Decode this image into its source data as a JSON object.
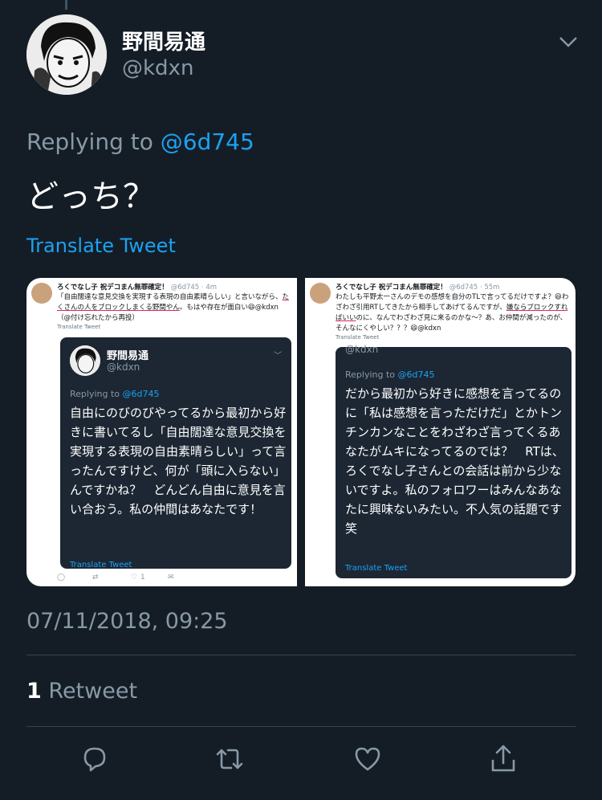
{
  "author": {
    "display_name": "野間易通",
    "handle": "@kdxn"
  },
  "reply": {
    "prefix": "Replying to",
    "target": "@6d745"
  },
  "tweet_text": "どっち？",
  "translate_label": "Translate Tweet",
  "timestamp": "07/11/2018, 09:25",
  "retweets": {
    "count": "1",
    "label": "Retweet"
  },
  "media": {
    "left": {
      "header_name": "ろくでなし子 祝デコまん無罪確定！",
      "header_meta": "@6d745 · 4m",
      "body_before": "「自由闊達な意見交換を実現する表現の自由素晴らしい」と言いながら、",
      "body_underlined": "たくさんの人をブロックしまくる野間やん",
      "body_after": "。もはや存在が面白い😆@kdxn （@付け忘れたから再投）",
      "translate": "Translate Tweet",
      "quoted": {
        "name": "野間易通",
        "handle": "@kdxn",
        "reply_prefix": "Replying to",
        "reply_target": "@6d745",
        "text": "自由にのびのびやってるから最初から好きに書いてるし「自由闊達な意見交換を実現する表現の自由素晴らしい」って言ったんですけど、何が「頭に入らない」んですかね？　どんどん自由に意見を言い合おう。私の仲間はあなたです！",
        "translate": "Translate Tweet"
      },
      "like_count": "1"
    },
    "right": {
      "header_name": "ろくでなし子 祝デコまん無罪確定！",
      "header_meta": "@6d745 · 55m",
      "body_before": "わたしも平野太一さんのデモの感想を自分のTLで言ってるだけですよ？😆わざわざ引用RTしてきたから相手してあげてるんですが、",
      "body_underlined": "嫌ならブロックすればいい",
      "body_after": "のに、なんでわざわざ見に来るのかな〜？あ、お仲間が減ったのが、そんなにくやしい？？？😆@kdxn",
      "translate": "Translate Tweet",
      "quoted": {
        "handle": "@kdxn",
        "reply_prefix": "Replying to",
        "reply_target": "@6d745",
        "text": "だから最初から好きに感想を言ってるのに「私は感想を言っただけだ」とかトンチンカンなことをわざわざ言ってくるあなたがムキになってるのでは？　RTは、ろくでなし子さんとの会話は前から少ないですよ。私のフォロワーはみんなあなたに興味ないみたい。不人気の話題です笑",
        "translate": "Translate Tweet"
      }
    }
  },
  "actions": {
    "reply": "reply-icon",
    "retweet": "retweet-icon",
    "like": "heart-icon",
    "share": "share-icon"
  },
  "colors": {
    "background": "#141d26",
    "accent": "#1da1f2",
    "muted": "#8899a6",
    "divider": "#38444d",
    "card": "#1c2733"
  }
}
